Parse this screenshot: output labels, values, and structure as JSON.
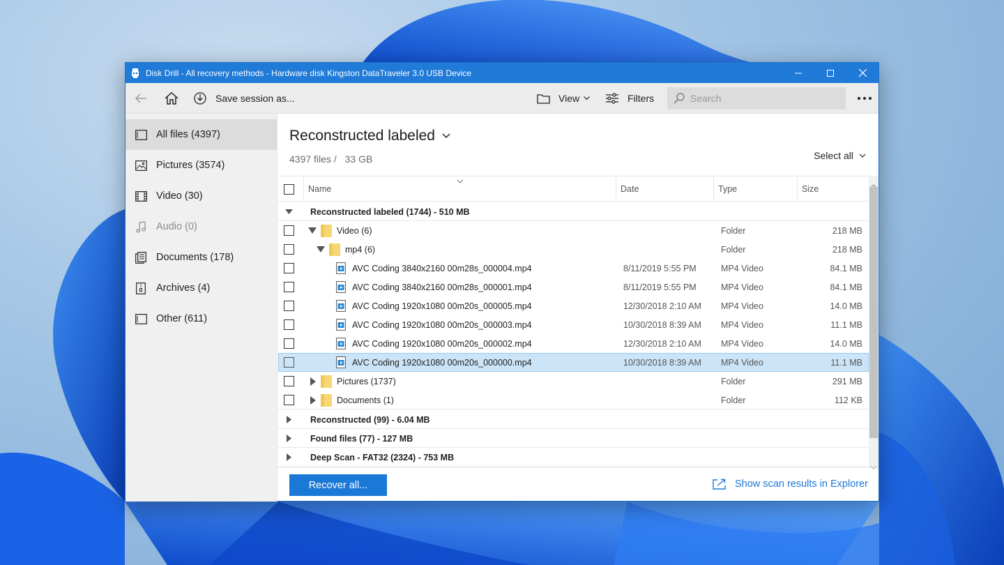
{
  "window": {
    "title": "Disk Drill - All recovery methods - Hardware disk Kingston DataTraveler 3.0 USB Device"
  },
  "toolbar": {
    "save_session": "Save session as...",
    "view": "View",
    "filters": "Filters",
    "search_placeholder": "Search"
  },
  "sidebar": {
    "items": [
      {
        "label": "All files (4397)",
        "icon": "all-files-icon"
      },
      {
        "label": "Pictures (3574)",
        "icon": "pictures-icon"
      },
      {
        "label": "Video (30)",
        "icon": "video-icon"
      },
      {
        "label": "Audio (0)",
        "icon": "audio-icon"
      },
      {
        "label": "Documents (178)",
        "icon": "documents-icon"
      },
      {
        "label": "Archives (4)",
        "icon": "archives-icon"
      },
      {
        "label": "Other (611)",
        "icon": "other-icon"
      }
    ]
  },
  "main": {
    "heading": "Reconstructed labeled",
    "files_count": "4397 files /",
    "files_size": "33 GB",
    "select_all": "Select all"
  },
  "table": {
    "headers": {
      "name": "Name",
      "date": "Date",
      "type": "Type",
      "size": "Size"
    },
    "groups": [
      {
        "label": "Reconstructed labeled (1744) - 510 MB"
      },
      {
        "label": "Reconstructed (99) - 6.04 MB"
      },
      {
        "label": "Found files (77) - 127 MB"
      },
      {
        "label": "Deep Scan - FAT32 (2324) - 753 MB"
      }
    ],
    "rows": [
      {
        "name": "Video (6)",
        "date": "",
        "type": "Folder",
        "size": "218 MB"
      },
      {
        "name": "mp4 (6)",
        "date": "",
        "type": "Folder",
        "size": "218 MB"
      },
      {
        "name": "AVC Coding 3840x2160 00m28s_000004.mp4",
        "date": "8/11/2019 5:55 PM",
        "type": "MP4 Video",
        "size": "84.1 MB"
      },
      {
        "name": "AVC Coding 3840x2160 00m28s_000001.mp4",
        "date": "8/11/2019 5:55 PM",
        "type": "MP4 Video",
        "size": "84.1 MB"
      },
      {
        "name": "AVC Coding 1920x1080 00m20s_000005.mp4",
        "date": "12/30/2018 2:10 AM",
        "type": "MP4 Video",
        "size": "14.0 MB"
      },
      {
        "name": "AVC Coding 1920x1080 00m20s_000003.mp4",
        "date": "10/30/2018 8:39 AM",
        "type": "MP4 Video",
        "size": "11.1 MB"
      },
      {
        "name": "AVC Coding 1920x1080 00m20s_000002.mp4",
        "date": "12/30/2018 2:10 AM",
        "type": "MP4 Video",
        "size": "14.0 MB"
      },
      {
        "name": "AVC Coding 1920x1080 00m20s_000000.mp4",
        "date": "10/30/2018 8:39 AM",
        "type": "MP4 Video",
        "size": "11.1 MB"
      },
      {
        "name": "Pictures (1737)",
        "date": "",
        "type": "Folder",
        "size": "291 MB"
      },
      {
        "name": "Documents (1)",
        "date": "",
        "type": "Folder",
        "size": "112 KB"
      }
    ]
  },
  "footer": {
    "recover_all": "Recover all...",
    "show_in_explorer": "Show scan results in Explorer"
  },
  "colors": {
    "accent": "#1a78d6",
    "titlebar": "#1f7ad8",
    "selected_row": "#cce4f7",
    "folder": "#f7d774"
  }
}
